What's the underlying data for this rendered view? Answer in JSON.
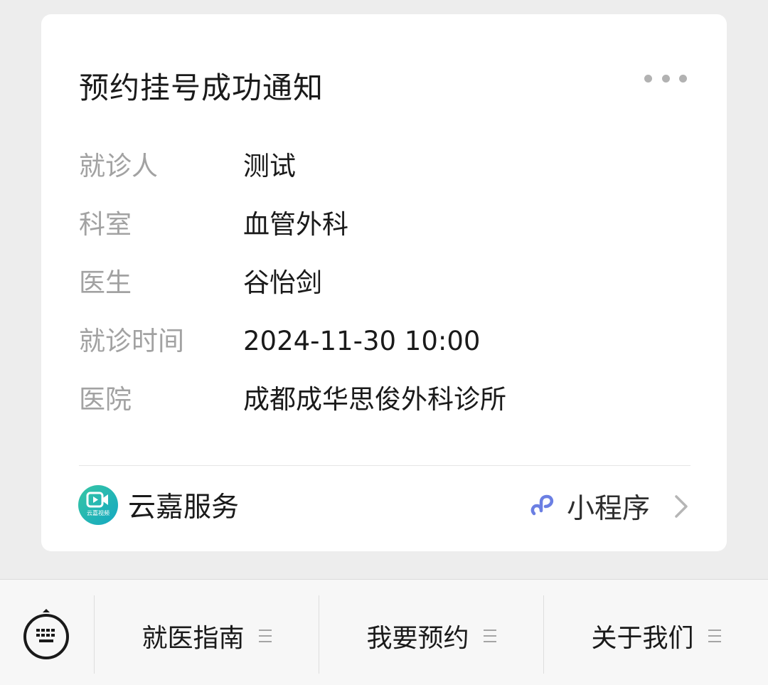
{
  "card": {
    "title": "预约挂号成功通知",
    "fields": [
      {
        "label": "就诊人",
        "value": "测试"
      },
      {
        "label": "科室",
        "value": "血管外科"
      },
      {
        "label": "医生",
        "value": "谷怡剑"
      },
      {
        "label": "就诊时间",
        "value": "2024-11-30 10:00"
      },
      {
        "label": "医院",
        "value": "成都成华思俊外科诊所"
      }
    ],
    "footer": {
      "brand_name": "云嘉服务",
      "brand_logo_text": "云嘉视频",
      "mini_program_label": "小程序"
    }
  },
  "bottom_menu": {
    "items": [
      {
        "label": "就医指南"
      },
      {
        "label": "我要预约"
      },
      {
        "label": "关于我们"
      }
    ]
  },
  "colors": {
    "brand_gradient_start": "#37c6a4",
    "brand_gradient_end": "#14a8c2",
    "mini_program_icon": "#6b7fe3",
    "label_gray": "#a2a2a2"
  },
  "icons": {
    "more": "more-dots-icon",
    "brand_logo": "video-camera-icon",
    "mini_program": "mini-program-link-icon",
    "chevron": "chevron-right-icon",
    "keyboard": "keyboard-icon",
    "menu": "hamburger-menu-icon"
  }
}
